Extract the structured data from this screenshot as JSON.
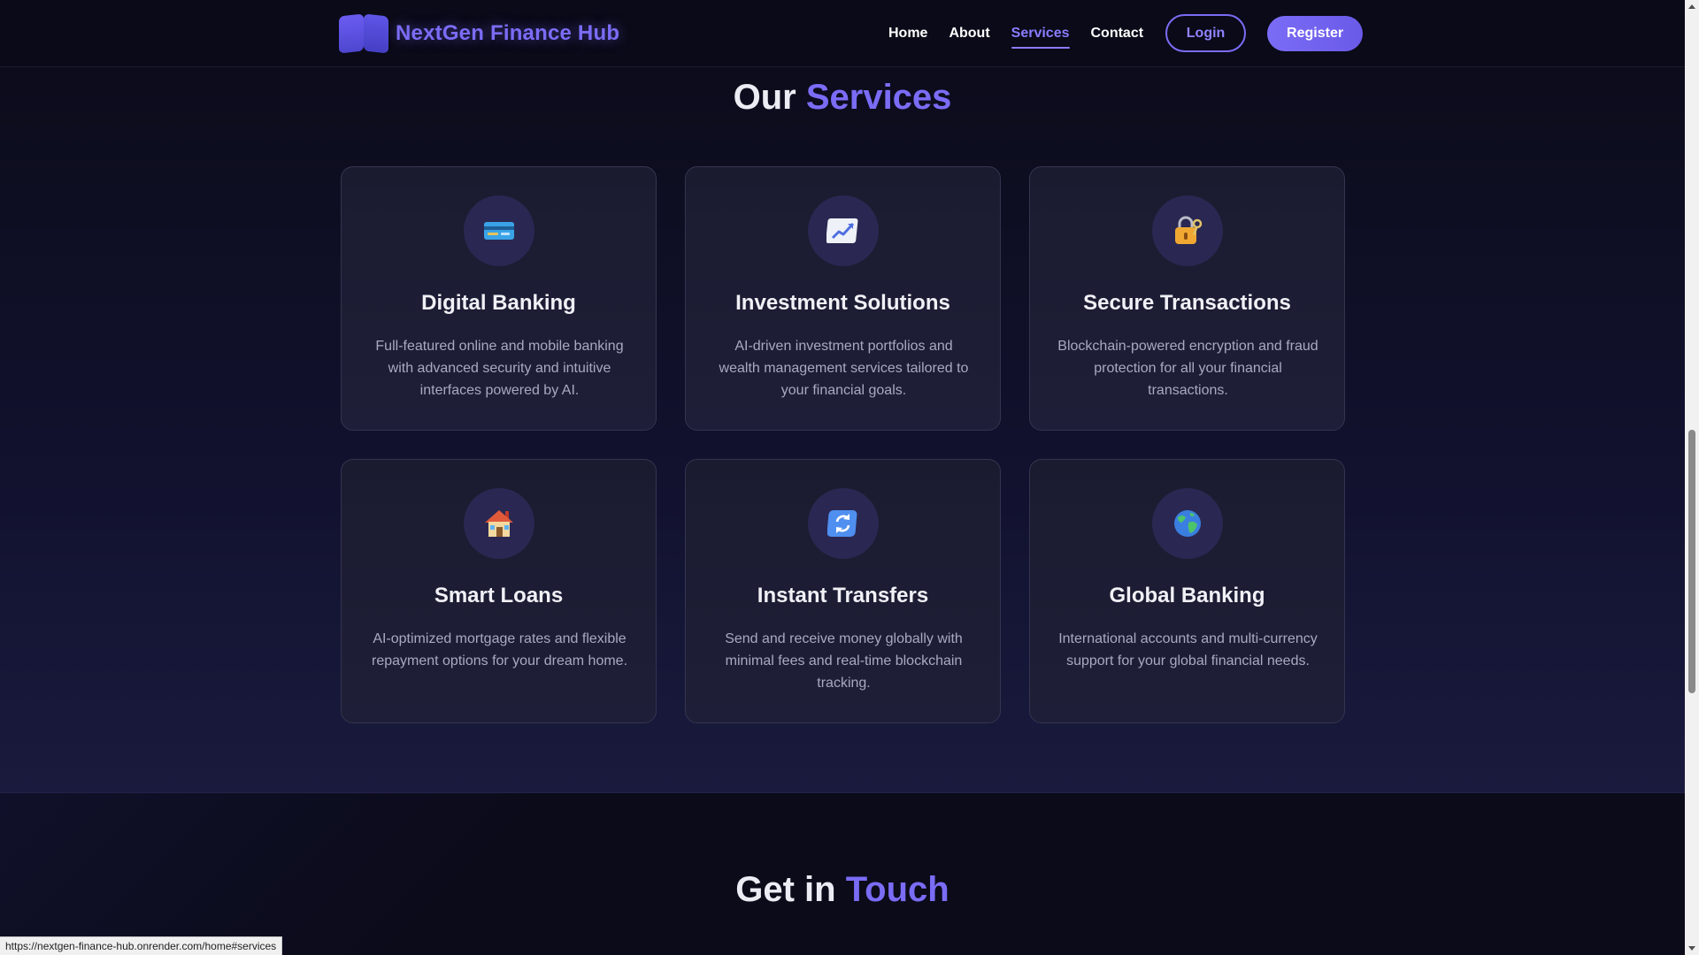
{
  "header": {
    "brand": "NextGen Finance Hub",
    "nav": [
      "Home",
      "About",
      "Services",
      "Contact"
    ],
    "active_nav": "Services",
    "login_label": "Login",
    "register_label": "Register"
  },
  "services": {
    "title_prefix": "Our",
    "title_accent": "Services",
    "cards": [
      {
        "icon": "credit-card-icon",
        "title": "Digital Banking",
        "desc": "Full-featured online and mobile banking with advanced security and intuitive interfaces powered by AI."
      },
      {
        "icon": "chart-increasing-icon",
        "title": "Investment Solutions",
        "desc": "AI-driven investment portfolios and wealth management services tailored to your financial goals."
      },
      {
        "icon": "lock-with-key-icon",
        "title": "Secure Transactions",
        "desc": "Blockchain-powered encryption and fraud protection for all your financial transactions."
      },
      {
        "icon": "house-icon",
        "title": "Smart Loans",
        "desc": "AI-optimized mortgage rates and flexible repayment options for your dream home."
      },
      {
        "icon": "refresh-arrows-icon",
        "title": "Instant Transfers",
        "desc": "Send and receive money globally with minimal fees and real-time blockchain tracking."
      },
      {
        "icon": "globe-icon",
        "title": "Global Banking",
        "desc": "International accounts and multi-currency support for your global financial needs."
      }
    ]
  },
  "contact": {
    "title_prefix": "Get in",
    "title_accent": "Touch"
  },
  "status_bar": {
    "url": "https://nextgen-finance-hub.onrender.com/home#services"
  },
  "colors": {
    "accent": "#7b6cf6",
    "background": "#0b0b1a",
    "card": "#1d1d34"
  }
}
